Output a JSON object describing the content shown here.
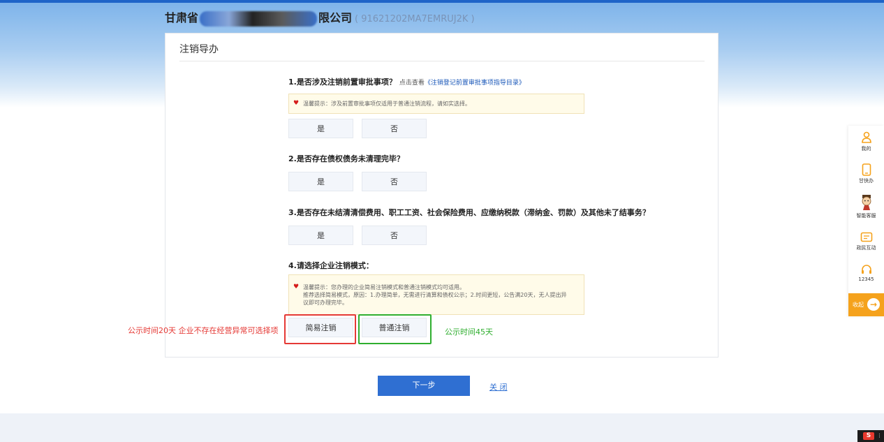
{
  "header": {
    "company_prefix": "甘肃省",
    "company_suffix": "限公司",
    "credit_code": "( 91621202MA7EMRUJ2K )"
  },
  "panel": {
    "title": "注销导办"
  },
  "questions": [
    {
      "text": "1.是否涉及注销前置审批事项？",
      "hint": "点击查看",
      "hint_link": "《注销登记前置审批事项指导目录》",
      "tip": "温馨提示：涉及前置审批事项仅适用于普通注销流程，请如实选择。",
      "options": [
        "是",
        "否"
      ]
    },
    {
      "text": "2.是否存在债权债务未清理完毕？",
      "options": [
        "是",
        "否"
      ]
    },
    {
      "text": "3.是否存在未结清清偿费用、职工工资、社会保险费用、应缴纳税款（滞纳金、罚款）及其他未了结事务？",
      "options": [
        "是",
        "否"
      ]
    },
    {
      "text": "4.请选择企业注销模式：",
      "tip_lines": [
        "温馨提示：您办理的企业简易注销模式和普通注销模式均可适用。",
        "推荐选择简易模式，原因：1.办理简单，无需进行清算和债权公示；2.时间更短，公告满20天，无人提出异",
        "议即可办理完毕。"
      ],
      "options": [
        "简易注销",
        "普通注销"
      ]
    }
  ],
  "annotations": {
    "left_note": "公示时间20天 企业不存在经营异常可选择项",
    "right_note": "公示时间45天"
  },
  "actions": {
    "next": "下一步",
    "close": "关 闭"
  },
  "side_dock": {
    "items": [
      {
        "label": "我的",
        "icon": "user-icon"
      },
      {
        "label": "甘快办",
        "icon": "phone-icon"
      },
      {
        "label": "智能客服",
        "icon": "robot-avatar-icon"
      },
      {
        "label": "政民互动",
        "icon": "chat-icon"
      },
      {
        "label": "12345",
        "icon": "headset-icon"
      }
    ],
    "collapse_label": "收起"
  },
  "colors": {
    "accent_blue": "#2f6fd2",
    "dock_orange": "#f5a21c",
    "annotation_red": "#e53935",
    "annotation_green": "#2fae2f"
  }
}
